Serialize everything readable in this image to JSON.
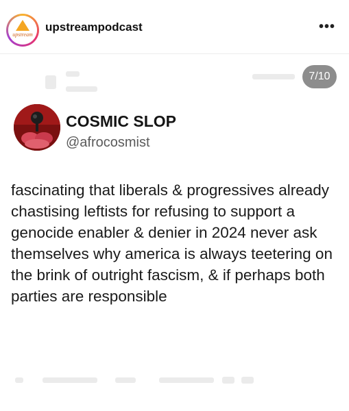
{
  "header": {
    "account_handle": "upstreampodcast",
    "avatar_text": "upstream",
    "more_label": "•••"
  },
  "carousel": {
    "counter": "7/10"
  },
  "tweet": {
    "author_name": "COSMIC SLOP",
    "author_handle": "@afrocosmist",
    "text": "fascinating that liberals & progressives already chastising leftists for refusing to support a genocide enabler & denier in 2024 never ask themselves why america is always teetering on the brink of outright fascism, & if perhaps both parties are responsible"
  },
  "colors": {
    "ring_gradient": [
      "#f9b42b",
      "#e8336d",
      "#a43fcf"
    ],
    "counter_bg": "#8d8d8d",
    "author_avatar_bg": "#8c1414"
  }
}
